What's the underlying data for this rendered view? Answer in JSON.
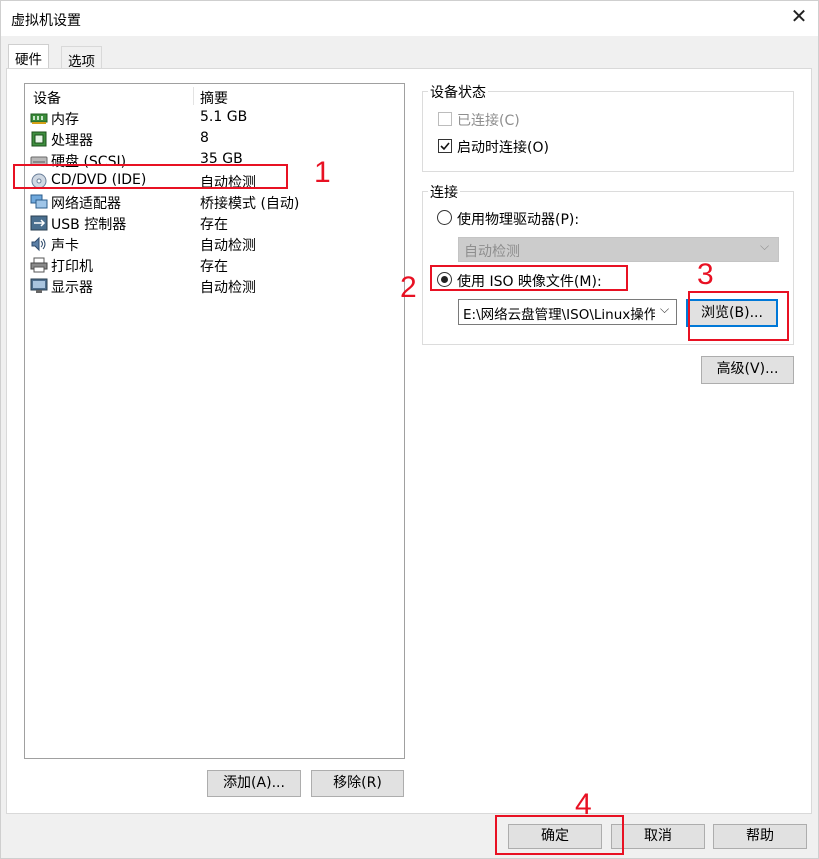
{
  "window": {
    "title": "虚拟机设置"
  },
  "tabs": [
    {
      "label": "硬件"
    },
    {
      "label": "选项"
    }
  ],
  "device_list": {
    "headers": {
      "device": "设备",
      "summary": "摘要"
    },
    "rows": [
      {
        "name": "内存",
        "summary": "5.1 GB",
        "icon": "memory-icon"
      },
      {
        "name": "处理器",
        "summary": "8",
        "icon": "processor-icon"
      },
      {
        "name": "硬盘 (SCSI)",
        "summary": "35 GB",
        "icon": "hard-disk-icon"
      },
      {
        "name": "CD/DVD (IDE)",
        "summary": "自动检测",
        "icon": "cd-dvd-icon"
      },
      {
        "name": "网络适配器",
        "summary": "桥接模式 (自动)",
        "icon": "network-adapter-icon"
      },
      {
        "name": "USB 控制器",
        "summary": "存在",
        "icon": "usb-icon"
      },
      {
        "name": "声卡",
        "summary": "自动检测",
        "icon": "sound-card-icon"
      },
      {
        "name": "打印机",
        "summary": "存在",
        "icon": "printer-icon"
      },
      {
        "name": "显示器",
        "summary": "自动检测",
        "icon": "display-icon"
      }
    ]
  },
  "device_buttons": {
    "add": "添加(A)...",
    "remove": "移除(R)"
  },
  "device_status": {
    "title": "设备状态",
    "connected": {
      "label": "已连接(C)",
      "checked": false,
      "enabled": false
    },
    "connect_on_power_on": {
      "label": "启动时连接(O)",
      "checked": true
    }
  },
  "connection": {
    "title": "连接",
    "physical_drive": {
      "label": "使用物理驱动器(P):",
      "selected": false,
      "dropdown_value": "自动检测"
    },
    "iso_image": {
      "label": "使用 ISO 映像文件(M):",
      "selected": true,
      "path_value": "E:\\网络云盘管理\\ISO\\Linux操作"
    },
    "browse_button": "浏览(B)..."
  },
  "advanced_button": "高级(V)...",
  "footer": {
    "ok": "确定",
    "cancel": "取消",
    "help": "帮助"
  },
  "annotations": [
    "1",
    "2",
    "3",
    "4"
  ],
  "colors": {
    "annotation_red": "#e81123",
    "selection_blue": "#0078d7"
  }
}
